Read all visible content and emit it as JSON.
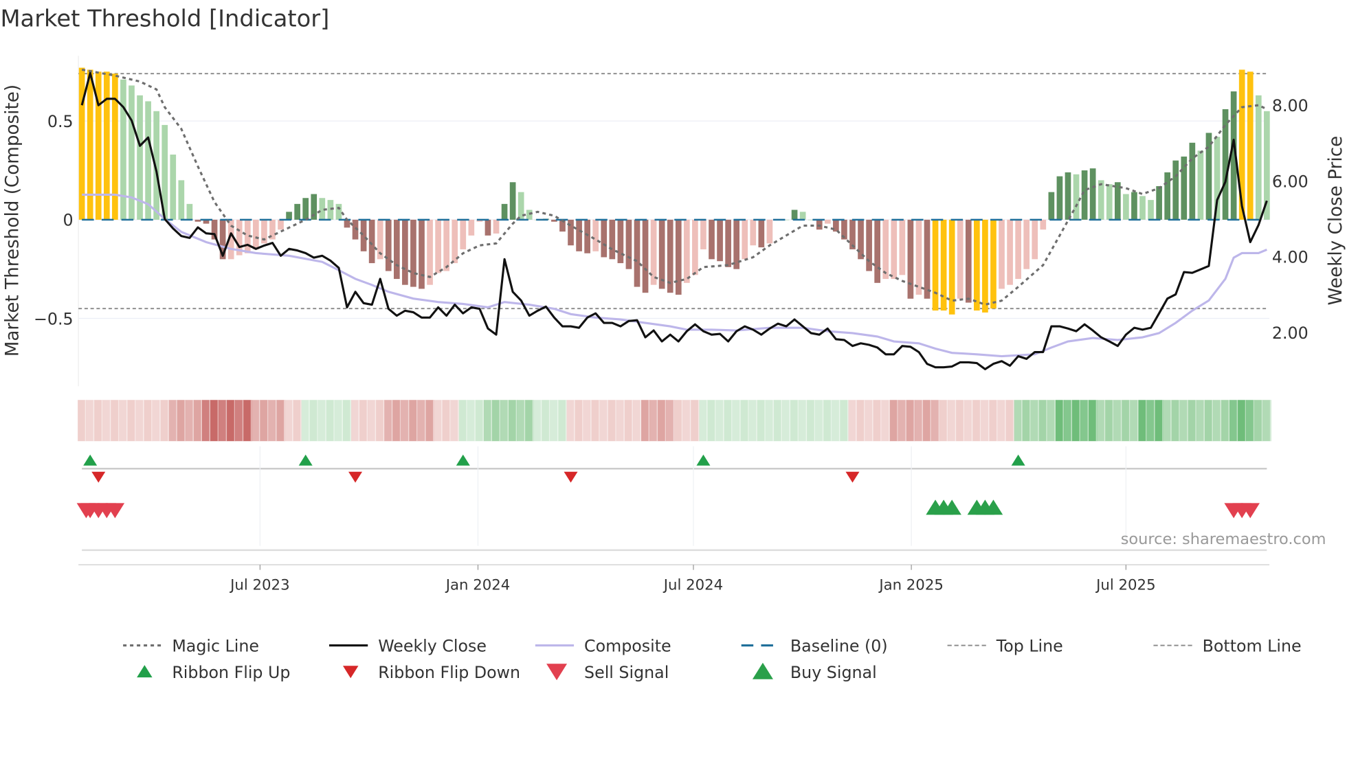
{
  "chart_data": {
    "type": "bar",
    "title": "Market Threshold [Indicator]",
    "ylabel_left": "Market Threshold (Composite)",
    "ylabel_right": "Weekly Close Price",
    "ylim_left": [
      -0.85,
      0.85
    ],
    "ylim_right": [
      0.2,
      9.3
    ],
    "left_ticks": [
      {
        "v": 0.5,
        "label": "0.5"
      },
      {
        "v": 0,
        "label": "0"
      },
      {
        "v": -0.5,
        "label": "−0.5"
      }
    ],
    "right_ticks": [
      {
        "v": 8,
        "label": "8.00"
      },
      {
        "v": 6,
        "label": "6.00"
      },
      {
        "v": 4,
        "label": "4.00"
      },
      {
        "v": 2,
        "label": "2.00"
      }
    ],
    "x_ticks": [
      {
        "week": 21.5,
        "label": "Jul 2023"
      },
      {
        "week": 47.8,
        "label": "Jan 2024"
      },
      {
        "week": 73.8,
        "label": "Jul 2024"
      },
      {
        "week": 100.1,
        "label": "Jan 2025"
      },
      {
        "week": 126,
        "label": "Jul 2025"
      }
    ],
    "weeks": 144,
    "top_line": 0.74,
    "bottom_line": -0.45,
    "baseline": 0,
    "composite_bars": [
      0.77,
      0.76,
      0.75,
      0.75,
      0.74,
      0.71,
      0.68,
      0.63,
      0.6,
      0.55,
      0.48,
      0.33,
      0.2,
      0.08,
      -0.01,
      -0.02,
      -0.1,
      -0.2,
      -0.2,
      -0.18,
      -0.17,
      -0.15,
      -0.12,
      -0.1,
      -0.05,
      0.04,
      0.08,
      0.11,
      0.13,
      0.11,
      0.1,
      0.08,
      -0.04,
      -0.1,
      -0.16,
      -0.22,
      -0.2,
      -0.26,
      -0.3,
      -0.33,
      -0.34,
      -0.35,
      -0.33,
      -0.27,
      -0.26,
      -0.22,
      -0.15,
      -0.08,
      -0.01,
      -0.08,
      -0.07,
      0.08,
      0.19,
      0.14,
      0.05,
      0,
      0.005,
      -0.01,
      -0.06,
      -0.13,
      -0.16,
      -0.17,
      -0.16,
      -0.19,
      -0.2,
      -0.22,
      -0.25,
      -0.34,
      -0.37,
      -0.33,
      -0.35,
      -0.37,
      -0.38,
      -0.32,
      -0.28,
      -0.15,
      -0.2,
      -0.21,
      -0.24,
      -0.25,
      -0.2,
      -0.13,
      -0.14,
      -0.12,
      0,
      0,
      0.05,
      0.04,
      0,
      -0.05,
      -0.02,
      -0.06,
      -0.1,
      -0.15,
      -0.2,
      -0.26,
      -0.32,
      -0.3,
      -0.3,
      -0.28,
      -0.4,
      -0.38,
      -0.4,
      -0.46,
      -0.46,
      -0.48,
      -0.4,
      -0.42,
      -0.46,
      -0.47,
      -0.45,
      -0.35,
      -0.33,
      -0.3,
      -0.25,
      -0.2,
      -0.05,
      0.14,
      0.22,
      0.24,
      0.23,
      0.25,
      0.26,
      0.2,
      0.18,
      0.19,
      0.13,
      0.14,
      0.12,
      0.1,
      0.17,
      0.24,
      0.3,
      0.32,
      0.39,
      0.35,
      0.44,
      0.42,
      0.56,
      0.65,
      0.76,
      0.75,
      0.63,
      0.55
    ],
    "weekly_close": [
      8.0,
      8.85,
      8.0,
      8.17,
      8.17,
      7.95,
      7.6,
      6.93,
      7.15,
      6.25,
      5.0,
      4.75,
      4.55,
      4.5,
      4.78,
      4.62,
      4.6,
      4.03,
      4.62,
      4.26,
      4.32,
      4.21,
      4.3,
      4.37,
      4.03,
      4.21,
      4.17,
      4.1,
      3.98,
      4.03,
      3.9,
      3.71,
      2.67,
      3.08,
      2.78,
      2.74,
      3.42,
      2.63,
      2.45,
      2.58,
      2.54,
      2.4,
      2.4,
      2.67,
      2.45,
      2.74,
      2.51,
      2.67,
      2.63,
      2.11,
      1.95,
      3.94,
      3.08,
      2.85,
      2.45,
      2.58,
      2.69,
      2.4,
      2.17,
      2.17,
      2.13,
      2.4,
      2.51,
      2.26,
      2.26,
      2.17,
      2.31,
      2.33,
      1.88,
      2.06,
      1.77,
      1.95,
      1.77,
      2.04,
      2.22,
      2.04,
      1.95,
      1.97,
      1.77,
      2.04,
      2.17,
      2.08,
      1.95,
      2.11,
      2.24,
      2.17,
      2.35,
      2.17,
      1.99,
      1.95,
      2.11,
      1.83,
      1.81,
      1.65,
      1.72,
      1.68,
      1.61,
      1.43,
      1.43,
      1.65,
      1.63,
      1.49,
      1.18,
      1.09,
      1.09,
      1.11,
      1.22,
      1.22,
      1.2,
      1.04,
      1.18,
      1.25,
      1.13,
      1.38,
      1.31,
      1.49,
      1.49,
      2.17,
      2.17,
      2.11,
      2.04,
      2.22,
      2.06,
      1.88,
      1.77,
      1.65,
      1.95,
      2.13,
      2.08,
      2.13,
      2.51,
      2.9,
      3.01,
      3.6,
      3.58,
      3.67,
      3.76,
      5.5,
      5.98,
      7.09,
      5.34,
      4.39,
      4.84,
      5.48
    ],
    "composite_line": [
      [
        0,
        5.64
      ],
      [
        4,
        5.64
      ],
      [
        6,
        5.57
      ],
      [
        8,
        5.39
      ],
      [
        10,
        5.0
      ],
      [
        12,
        4.66
      ],
      [
        15,
        4.39
      ],
      [
        18,
        4.21
      ],
      [
        21,
        4.1
      ],
      [
        25,
        4.03
      ],
      [
        29,
        3.87
      ],
      [
        31,
        3.65
      ],
      [
        33,
        3.42
      ],
      [
        35,
        3.26
      ],
      [
        37,
        3.08
      ],
      [
        40,
        2.9
      ],
      [
        43,
        2.81
      ],
      [
        46,
        2.76
      ],
      [
        49,
        2.67
      ],
      [
        51,
        2.81
      ],
      [
        54,
        2.74
      ],
      [
        57,
        2.63
      ],
      [
        59,
        2.49
      ],
      [
        62,
        2.4
      ],
      [
        65,
        2.35
      ],
      [
        68,
        2.26
      ],
      [
        71,
        2.17
      ],
      [
        73,
        2.08
      ],
      [
        76,
        2.08
      ],
      [
        79,
        2.06
      ],
      [
        83,
        2.13
      ],
      [
        87,
        2.13
      ],
      [
        90,
        2.04
      ],
      [
        93,
        1.99
      ],
      [
        96,
        1.9
      ],
      [
        98,
        1.77
      ],
      [
        101,
        1.72
      ],
      [
        103,
        1.58
      ],
      [
        105,
        1.47
      ],
      [
        108,
        1.43
      ],
      [
        111,
        1.38
      ],
      [
        115,
        1.43
      ],
      [
        117,
        1.61
      ],
      [
        119,
        1.77
      ],
      [
        122,
        1.86
      ],
      [
        125,
        1.81
      ],
      [
        128,
        1.88
      ],
      [
        130,
        1.99
      ],
      [
        132,
        2.26
      ],
      [
        134,
        2.58
      ],
      [
        136,
        2.85
      ],
      [
        138,
        3.42
      ],
      [
        139,
        3.98
      ],
      [
        140,
        4.1
      ],
      [
        142,
        4.1
      ],
      [
        143,
        4.19
      ]
    ],
    "magic_line": [
      [
        0,
        0.76
      ],
      [
        4,
        0.73
      ],
      [
        7,
        0.7
      ],
      [
        9,
        0.66
      ],
      [
        10,
        0.57
      ],
      [
        12,
        0.46
      ],
      [
        14,
        0.27
      ],
      [
        16,
        0.09
      ],
      [
        18,
        -0.03
      ],
      [
        20,
        -0.08
      ],
      [
        22,
        -0.1
      ],
      [
        24,
        -0.06
      ],
      [
        27,
        0.0
      ],
      [
        29,
        0.05
      ],
      [
        31,
        0.06
      ],
      [
        32,
        0.0
      ],
      [
        34,
        -0.08
      ],
      [
        36,
        -0.17
      ],
      [
        38,
        -0.23
      ],
      [
        40,
        -0.27
      ],
      [
        42,
        -0.29
      ],
      [
        44,
        -0.24
      ],
      [
        46,
        -0.17
      ],
      [
        48,
        -0.13
      ],
      [
        50,
        -0.12
      ],
      [
        52,
        -0.02
      ],
      [
        53,
        0.02
      ],
      [
        55,
        0.04
      ],
      [
        57,
        0.02
      ],
      [
        59,
        -0.03
      ],
      [
        62,
        -0.1
      ],
      [
        64,
        -0.15
      ],
      [
        67,
        -0.21
      ],
      [
        69,
        -0.29
      ],
      [
        71,
        -0.32
      ],
      [
        73,
        -0.3
      ],
      [
        75,
        -0.24
      ],
      [
        78,
        -0.23
      ],
      [
        81,
        -0.19
      ],
      [
        83,
        -0.13
      ],
      [
        85,
        -0.08
      ],
      [
        87,
        -0.03
      ],
      [
        89,
        -0.03
      ],
      [
        91,
        -0.05
      ],
      [
        93,
        -0.13
      ],
      [
        95,
        -0.21
      ],
      [
        97,
        -0.27
      ],
      [
        99,
        -0.31
      ],
      [
        103,
        -0.37
      ],
      [
        105,
        -0.41
      ],
      [
        107,
        -0.4
      ],
      [
        109,
        -0.43
      ],
      [
        111,
        -0.41
      ],
      [
        113,
        -0.34
      ],
      [
        116,
        -0.23
      ],
      [
        118,
        -0.08
      ],
      [
        120,
        0.07
      ],
      [
        121,
        0.15
      ],
      [
        123,
        0.18
      ],
      [
        126,
        0.16
      ],
      [
        128,
        0.13
      ],
      [
        130,
        0.16
      ],
      [
        132,
        0.22
      ],
      [
        134,
        0.31
      ],
      [
        136,
        0.37
      ],
      [
        138,
        0.48
      ],
      [
        140,
        0.57
      ],
      [
        142,
        0.58
      ],
      [
        143,
        0.56
      ]
    ],
    "ribbon": [
      -1,
      -1,
      -1,
      -1,
      -1,
      -1,
      -1,
      -1,
      -1,
      -1,
      -1,
      -2,
      -2,
      -2,
      -2,
      -3,
      -3,
      -3,
      -3,
      -3,
      -3,
      -2,
      -2,
      -2,
      -2,
      -1,
      -1,
      1,
      1,
      1,
      1,
      1,
      1,
      -1,
      -1,
      -1,
      -1,
      -2,
      -2,
      -2,
      -2,
      -2,
      -2,
      -1,
      -1,
      -1,
      1,
      1,
      1,
      2,
      2,
      2,
      2,
      2,
      2,
      1,
      1,
      1,
      1,
      -1,
      -1,
      -1,
      -1,
      -1,
      -1,
      -1,
      -1,
      -1,
      -2,
      -2,
      -2,
      -2,
      -1,
      -1,
      -1,
      1,
      1,
      1,
      1,
      1,
      1,
      1,
      1,
      1,
      1,
      1,
      1,
      1,
      1,
      1,
      1,
      1,
      1,
      -1,
      -1,
      -1,
      -1,
      -1,
      -2,
      -2,
      -2,
      -2,
      -2,
      -2,
      -1,
      -1,
      -1,
      -1,
      -1,
      -1,
      -1,
      -1,
      -1,
      2,
      2,
      2,
      2,
      2,
      3,
      3,
      3,
      3,
      3,
      2,
      2,
      2,
      2,
      2,
      3,
      3,
      3,
      2,
      2,
      2,
      2,
      2,
      2,
      2,
      2,
      3,
      3,
      3,
      2,
      2
    ],
    "ribbon_flip_up_weeks": [
      1,
      27,
      46,
      75,
      113
    ],
    "ribbon_flip_down_weeks": [
      2,
      33,
      59,
      93
    ],
    "sell_signal_weeks": [
      0,
      1,
      2,
      3,
      4,
      139,
      140,
      141
    ],
    "buy_signal_weeks": [
      103,
      104,
      105,
      108,
      109,
      110
    ],
    "colors": {
      "extreme": "#ffc20e",
      "bull_strong": "#5e9160",
      "bull_weak": "#abd6ab",
      "bear_strong": "#a8726d",
      "bear_weak": "#eebfba",
      "close": "#111111",
      "composite": "#bdb6ea",
      "magic": "#6e6e6e",
      "baseline": "#1f6f9a",
      "flip_up": "#22a04a",
      "flip_down": "#d62728",
      "sell": "#e2404f",
      "buy": "#2aa04a"
    },
    "legend": [
      {
        "label": "Magic Line",
        "kind": "dotted",
        "color": "#6e6e6e"
      },
      {
        "label": "Weekly Close",
        "kind": "solid",
        "color": "#111111"
      },
      {
        "label": "Composite",
        "kind": "solid",
        "color": "#bdb6ea"
      },
      {
        "label": "Baseline (0)",
        "kind": "dashed",
        "color": "#1f6f9a"
      },
      {
        "label": "Top Line",
        "kind": "thin-dash",
        "color": "#888888"
      },
      {
        "label": "Bottom Line",
        "kind": "thin-dash",
        "color": "#888888"
      },
      {
        "label": "Ribbon Flip Up",
        "kind": "tri-up",
        "color": "#22a04a"
      },
      {
        "label": "Ribbon Flip Down",
        "kind": "tri-down",
        "color": "#d62728"
      },
      {
        "label": "Sell Signal",
        "kind": "tri-down-big",
        "color": "#e2404f"
      },
      {
        "label": "Buy Signal",
        "kind": "tri-up-big",
        "color": "#2aa04a"
      }
    ],
    "source": "source: sharemaestro.com"
  }
}
